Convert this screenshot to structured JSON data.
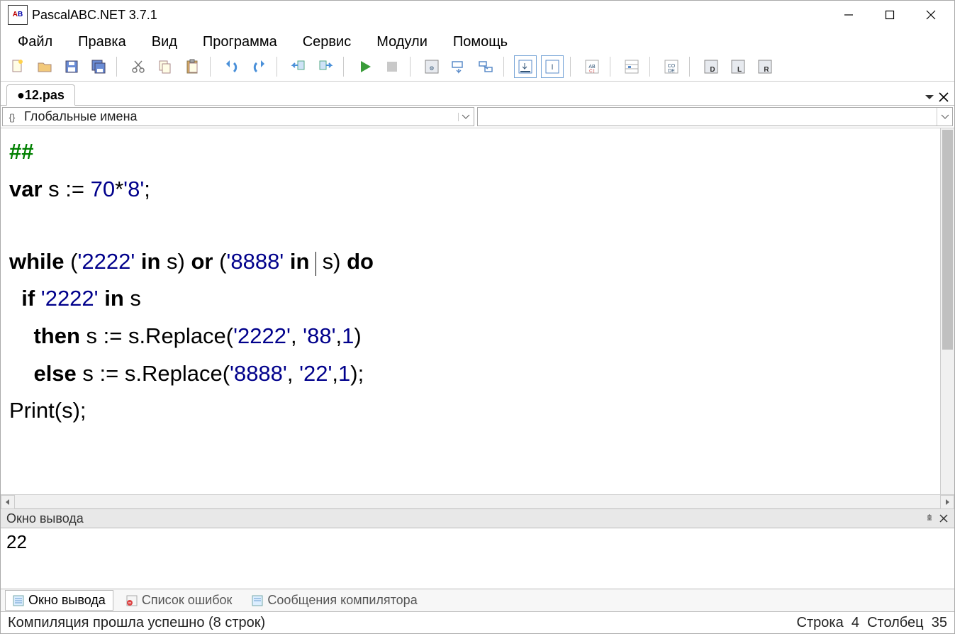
{
  "window": {
    "title": "PascalABC.NET 3.7.1",
    "app_icon_text": "AB\n.net"
  },
  "menu": {
    "items": [
      "Файл",
      "Правка",
      "Вид",
      "Программа",
      "Сервис",
      "Модули",
      "Помощь"
    ]
  },
  "tabs": {
    "file": "●12.pas"
  },
  "nav": {
    "scope": "Глобальные имена"
  },
  "code": {
    "l1": "##",
    "l2_var": "var",
    "l2_rest": " s := ",
    "l2_num": "70",
    "l2_op": "*",
    "l2_str": "'8'",
    "l2_end": ";",
    "l4_while": "while",
    "l4_p1": " (",
    "l4_s1": "'2222'",
    "l4_in1": " in ",
    "l4_id1": "s) ",
    "l4_or": "or",
    "l4_p2": " (",
    "l4_s2": "'8888'",
    "l4_in2": " in ",
    "l4_id2": " s) ",
    "l4_do": "do",
    "l5_if": "  if ",
    "l5_s1": "'2222'",
    "l5_in": " in ",
    "l5_id": "s",
    "l6_then": "    then",
    "l6_rest": " s := s.Replace(",
    "l6_s1": "'2222'",
    "l6_c1": ", ",
    "l6_s2": "'88'",
    "l6_c2": ",",
    "l6_n": "1",
    "l6_end": ")",
    "l7_else": "    else",
    "l7_rest": " s := s.Replace(",
    "l7_s1": "'8888'",
    "l7_c1": ", ",
    "l7_s2": "'22'",
    "l7_c2": ",",
    "l7_n": "1",
    "l7_end": ");",
    "l8": "Print(s);"
  },
  "output": {
    "header": "Окно вывода",
    "text": "22"
  },
  "bottom_tabs": {
    "t1": "Окно вывода",
    "t2": "Список ошибок",
    "t3": "Сообщения компилятора"
  },
  "status": {
    "left": "Компиляция прошла успешно (8 строк)",
    "right_label_row": "Строка",
    "right_row": "4",
    "right_label_col": "Столбец",
    "right_col": "35"
  }
}
